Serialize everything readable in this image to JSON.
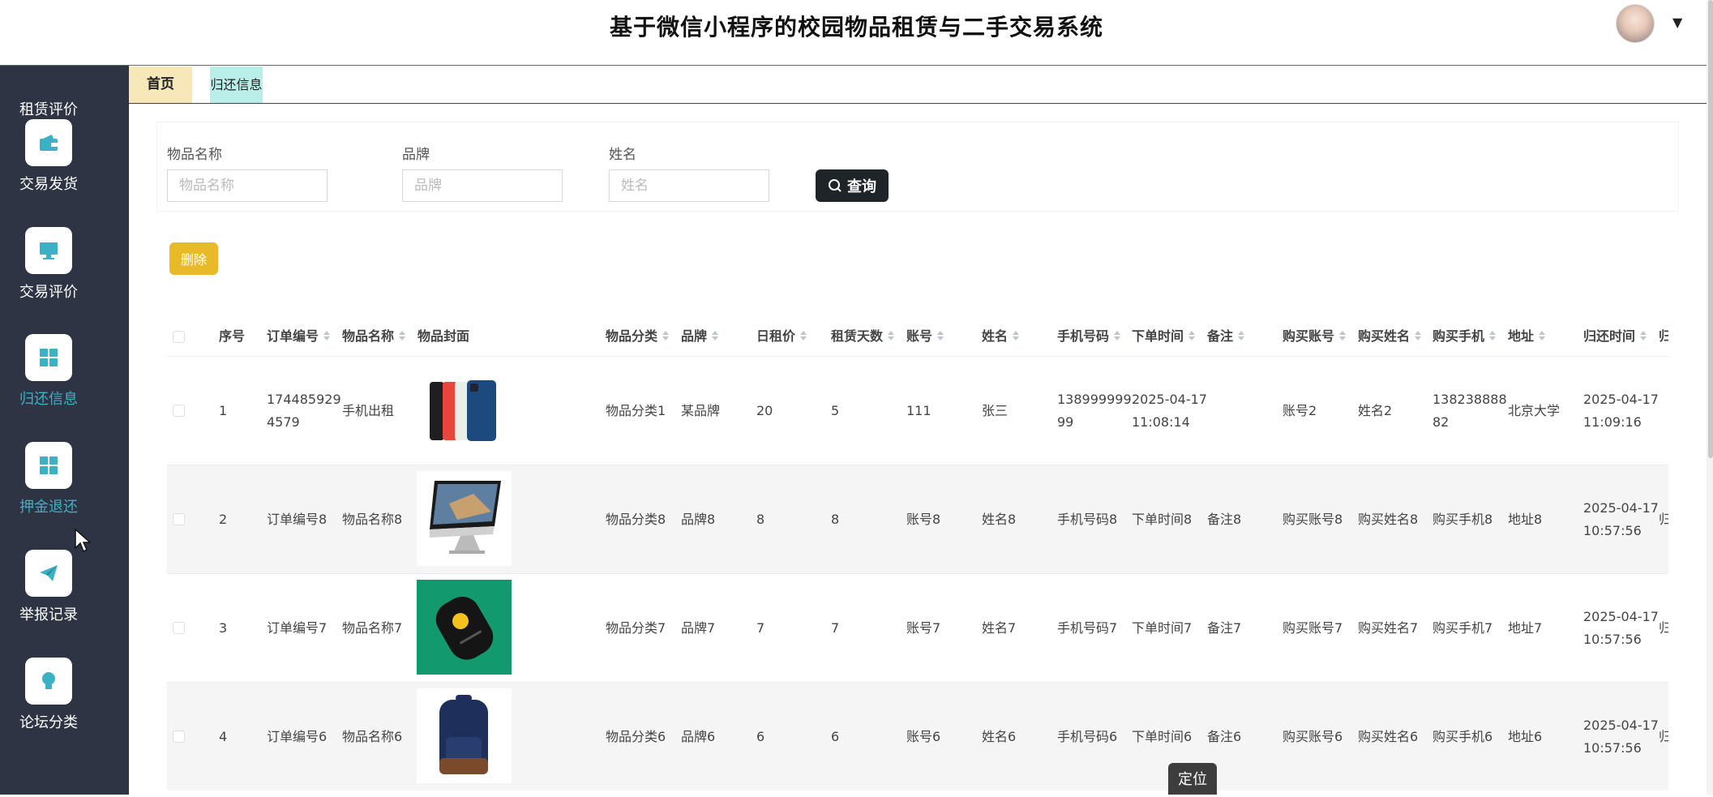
{
  "header": {
    "title": "基于微信小程序的校园物品租赁与二手交易系统"
  },
  "sidebar": {
    "items": [
      {
        "label": "租赁评价",
        "icon": "chat-icon"
      },
      {
        "label": "交易发货",
        "icon": "wallet-icon"
      },
      {
        "label": "交易评价",
        "icon": "monitor-icon"
      },
      {
        "label": "归还信息",
        "icon": "grid-icon",
        "active": true
      },
      {
        "label": "押金退还",
        "icon": "grid-icon"
      },
      {
        "label": "举报记录",
        "icon": "paper-plane-icon"
      },
      {
        "label": "论坛分类",
        "icon": "bulb-icon"
      }
    ]
  },
  "tabs": [
    {
      "label": "首页"
    },
    {
      "label": "归还信息"
    }
  ],
  "filter": {
    "fields": [
      {
        "label": "物品名称",
        "placeholder": "物品名称"
      },
      {
        "label": "品牌",
        "placeholder": "品牌"
      },
      {
        "label": "姓名",
        "placeholder": "姓名"
      }
    ],
    "query_label": "查询"
  },
  "delete_label": "删除",
  "table": {
    "columns": [
      "序号",
      "订单编号",
      "物品名称",
      "物品封面",
      "物品分类",
      "品牌",
      "日租价",
      "租赁天数",
      "账号",
      "姓名",
      "手机号码",
      "下单时间",
      "备注",
      "购买账号",
      "购买姓名",
      "购买手机",
      "地址",
      "归还时间",
      "归"
    ],
    "rows": [
      {
        "no": "1",
        "order_l1": "174485929",
        "order_l2": "4579",
        "name": "手机出租",
        "cover": "phones",
        "category": "物品分类1",
        "brand": "某品牌",
        "price": "20",
        "days": "5",
        "account": "111",
        "person": "张三",
        "phone_l1": "138999999",
        "phone_l2": "99",
        "time_l1": "2025-04-17",
        "time_l2": "11:08:14",
        "remark": "",
        "buy_account": "账号2",
        "buy_name": "姓名2",
        "buy_phone_l1": "138238888",
        "buy_phone_l2": "82",
        "address": "北京大学",
        "return_l1": "2025-04-17",
        "return_l2": "11:09:16",
        "extra": ""
      },
      {
        "no": "2",
        "order": "订单编号8",
        "name": "物品名称8",
        "cover": "imac",
        "category": "物品分类8",
        "brand": "品牌8",
        "price": "8",
        "days": "8",
        "account": "账号8",
        "person": "姓名8",
        "phone": "手机号码8",
        "time": "下单时间8",
        "remark": "备注8",
        "buy_account": "购买账号8",
        "buy_name": "购买姓名8",
        "buy_phone": "购买手机8",
        "address": "地址8",
        "return_l1": "2025-04-17",
        "return_l2": "10:57:56",
        "extra": "归"
      },
      {
        "no": "3",
        "order": "订单编号7",
        "name": "物品名称7",
        "cover": "gadget",
        "category": "物品分类7",
        "brand": "品牌7",
        "price": "7",
        "days": "7",
        "account": "账号7",
        "person": "姓名7",
        "phone": "手机号码7",
        "time": "下单时间7",
        "remark": "备注7",
        "buy_account": "购买账号7",
        "buy_name": "购买姓名7",
        "buy_phone": "购买手机7",
        "address": "地址7",
        "return_l1": "2025-04-17",
        "return_l2": "10:57:56",
        "extra": "归"
      },
      {
        "no": "4",
        "order": "订单编号6",
        "name": "物品名称6",
        "cover": "backpack",
        "category": "物品分类6",
        "brand": "品牌6",
        "price": "6",
        "days": "6",
        "account": "账号6",
        "person": "姓名6",
        "phone": "手机号码6",
        "time": "下单时间6",
        "remark": "备注6",
        "buy_account": "购买账号6",
        "buy_name": "购买姓名6",
        "buy_phone": "购买手机6",
        "address": "地址6",
        "return_l1": "2025-04-17",
        "return_l2": "10:57:56",
        "extra": "归"
      }
    ]
  },
  "locate_label": "定位",
  "colors": {
    "sidebar_bg": "#2e3443",
    "active": "#3cb0c4",
    "query_btn": "#1f2429",
    "delete_btn": "#e8b928",
    "home_tab": "#f6e8b8",
    "return_tab": "#b9eee9"
  }
}
